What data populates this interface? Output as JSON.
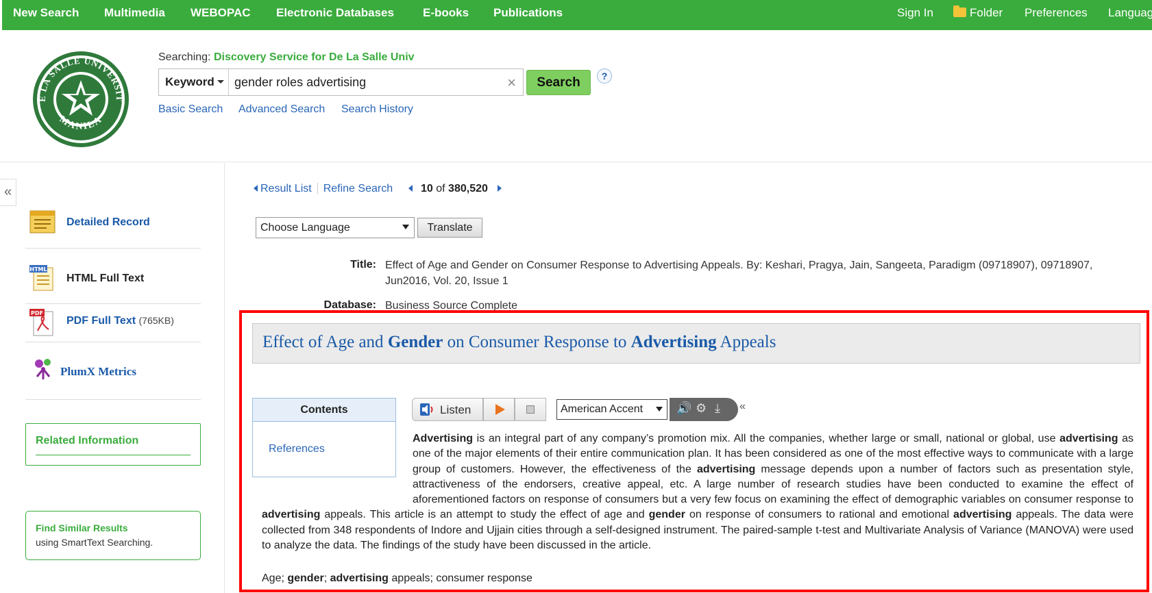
{
  "topnav": {
    "items": [
      "New Search",
      "Multimedia",
      "WEBOPAC",
      "Electronic Databases",
      "E-books",
      "Publications"
    ],
    "right": [
      "Sign In",
      "Folder",
      "Preferences",
      "Languag"
    ]
  },
  "colors": {
    "brand_green": "#3aac3d",
    "link_blue": "#2a66b8",
    "search_button": "#7fcf60",
    "highlight_border": "#ff0000"
  },
  "header": {
    "logo_text": "DE LA SALLE UNIVERSITY MANILA",
    "searching_label": "Searching:",
    "service": "Discovery Service for De La Salle Univ",
    "field": "Keyword",
    "query": "gender roles advertising",
    "search_button": "Search",
    "help": "?",
    "links": [
      "Basic Search",
      "Advanced Search",
      "Search History"
    ]
  },
  "sidebar": {
    "collapse": "«",
    "detailed_record": "Detailed Record",
    "html_full_text": "HTML Full Text",
    "pdf_full_text": "PDF Full Text",
    "pdf_size": "(765KB)",
    "plumx": "PlumX Metrics",
    "related": "Related Information",
    "similar_title": "Find Similar Results",
    "similar_sub": "using SmartText Searching.",
    "icons": [
      "detailed-record-icon",
      "html-full-text-icon",
      "pdf-icon",
      "plumx-icon"
    ]
  },
  "record_nav": {
    "result_list": "Result List",
    "refine": "Refine Search",
    "position": "10",
    "of": "of",
    "total": "380,520"
  },
  "translate": {
    "language": "Choose Language",
    "button": "Translate"
  },
  "meta": {
    "title_label": "Title:",
    "title_value_1": "Effect of Age and Gender on Consumer Response to Advertising Appeals. By: Keshari, Pragya, Jain, Sangeeta, Paradigm (09718907), 09718907,",
    "title_value_2": "Jun2016, Vol. 20, Issue 1",
    "database_label": "Database:",
    "database_value": "Business Source Complete"
  },
  "article": {
    "title_parts": [
      "Effect of Age and ",
      "Gender",
      " on Consumer Response to ",
      "Advertising",
      " Appeals"
    ],
    "contents_header": "Contents",
    "contents_ref": "References",
    "player": {
      "listen": "Listen",
      "accent": "American Accent",
      "collapse": "«"
    },
    "abstract": [
      {
        "b": "Advertising"
      },
      " is an integral part of any company’s promotion mix. All the companies, whether large or small, national or global, use ",
      {
        "b": "advertising"
      },
      " as one of the major elements of their entire communication plan. It has been considered as one of the most effective ways to communicate with a large group of customers. However, the effectiveness of the ",
      {
        "b": "advertising"
      },
      " message depends upon a number of factors such as presentation style, attractiveness of the endorsers, creative appeal, etc. A large number of research studies have been conducted to examine the effect of aforementioned factors on response of consumers but a very few focus on examining the effect of demographic variables on consumer response to ",
      {
        "b": "advertising"
      },
      " appeals. This article is an attempt to study the effect of age and ",
      {
        "b": "gender"
      },
      " on response of consumers to rational and emotional ",
      {
        "b": "advertising"
      },
      " appeals. The data were collected from 348 respondents of Indore and Ujjain cities through a self-designed instrument. The paired-sample t-test and Multivariate Analysis of Variance (MANOVA) were used to analyze the data. The findings of the study have been discussed in the article."
    ],
    "keywords": [
      "Age; ",
      {
        "b": "gender"
      },
      "; ",
      {
        "b": "advertising"
      },
      " appeals; consumer response"
    ]
  }
}
